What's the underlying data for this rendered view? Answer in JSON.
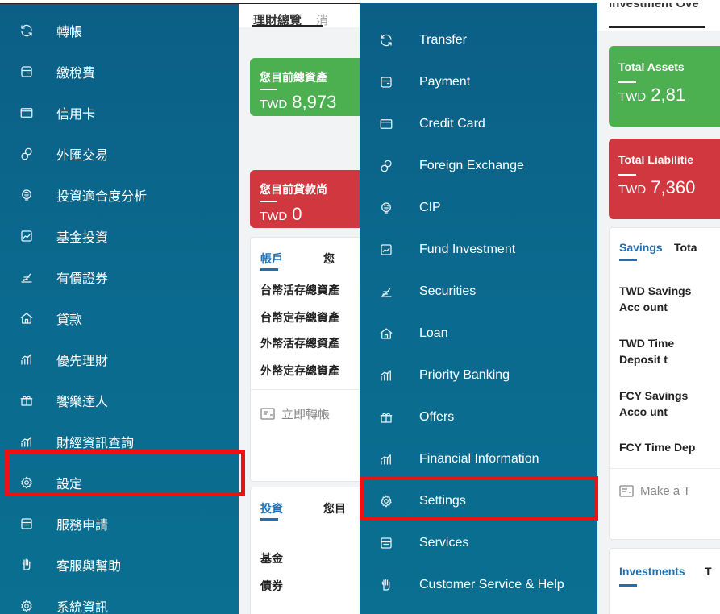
{
  "left": {
    "menu": [
      {
        "icon": "transfer-icon",
        "label": "轉帳"
      },
      {
        "icon": "payment-icon",
        "label": "繳稅費"
      },
      {
        "icon": "credit-card-icon",
        "label": "信用卡"
      },
      {
        "icon": "foreign-exchange-icon",
        "label": "外匯交易"
      },
      {
        "icon": "cip-icon",
        "label": "投資適合度分析"
      },
      {
        "icon": "fund-investment-icon",
        "label": "基金投資"
      },
      {
        "icon": "securities-icon",
        "label": "有價證券"
      },
      {
        "icon": "loan-icon",
        "label": "貸款"
      },
      {
        "icon": "priority-banking-icon",
        "label": "優先理財"
      },
      {
        "icon": "offers-icon",
        "label": "饗樂達人"
      },
      {
        "icon": "financial-information-icon",
        "label": "財經資訊查詢"
      },
      {
        "icon": "settings-icon",
        "label": "設定",
        "highlighted": true
      },
      {
        "icon": "services-icon",
        "label": "服務申請"
      },
      {
        "icon": "customer-service-icon",
        "label": "客服與幫助"
      },
      {
        "icon": "system-info-icon",
        "label": "系統資訊"
      }
    ],
    "content": {
      "tab_active": "理財總覽",
      "tab_inactive": "消",
      "assets_card": {
        "title": "您目前總資產",
        "currency": "TWD",
        "amount": "8,973"
      },
      "liabilities_card": {
        "title": "您目前貸款尚",
        "currency": "TWD",
        "amount": "0"
      },
      "accounts_box": {
        "tab1": "帳戶",
        "tab2": "您",
        "rows": [
          "台幣活存總資產",
          "台幣定存總資產",
          "外幣活存總資產",
          "外幣定存總資產"
        ],
        "transfer_link": "立即轉帳"
      },
      "investments_box": {
        "tab1": "投資",
        "tab2": "您目",
        "rows": [
          "基金",
          "債券"
        ]
      }
    }
  },
  "right": {
    "menu": [
      {
        "icon": "transfer-icon",
        "label": "Transfer"
      },
      {
        "icon": "payment-icon",
        "label": "Payment"
      },
      {
        "icon": "credit-card-icon",
        "label": "Credit Card"
      },
      {
        "icon": "foreign-exchange-icon",
        "label": "Foreign Exchange"
      },
      {
        "icon": "cip-icon",
        "label": "CIP"
      },
      {
        "icon": "fund-investment-icon",
        "label": "Fund Investment"
      },
      {
        "icon": "securities-icon",
        "label": "Securities"
      },
      {
        "icon": "loan-icon",
        "label": "Loan"
      },
      {
        "icon": "priority-banking-icon",
        "label": "Priority Banking"
      },
      {
        "icon": "offers-icon",
        "label": "Offers"
      },
      {
        "icon": "financial-information-icon",
        "label": "Financial Information"
      },
      {
        "icon": "settings-icon",
        "label": "Settings",
        "highlighted": true
      },
      {
        "icon": "services-icon",
        "label": "Services"
      },
      {
        "icon": "customer-service-icon",
        "label": "Customer Service & Help"
      }
    ],
    "content": {
      "tab_active": "Investment Ove",
      "assets_card": {
        "title": "Total Assets",
        "currency": "TWD",
        "amount": "2,81"
      },
      "liabilities_card": {
        "title": "Total Liabilitie",
        "currency": "TWD",
        "amount": "7,360"
      },
      "accounts_box": {
        "tab1": "Savings",
        "tab2": "Tota",
        "rows": [
          "TWD Savings Acc ount",
          "TWD Time Deposit t",
          "FCY Savings Acco unt",
          "FCY Time Dep"
        ],
        "transfer_link": "Make a T"
      },
      "investments_box": {
        "tab1": "Investments",
        "tab2": "T"
      }
    }
  },
  "colors": {
    "sidebar": "#0b6a8f",
    "highlight": "#ee1111",
    "assets": "#4caf50",
    "liabilities": "#d1373f",
    "link": "#1f6fb2"
  }
}
